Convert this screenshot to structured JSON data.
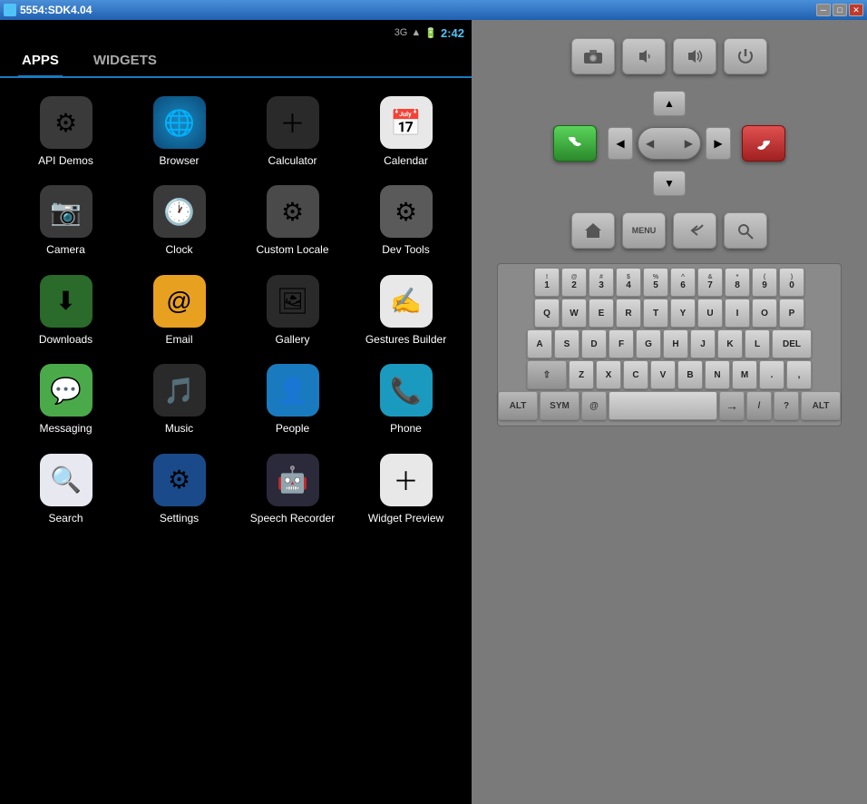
{
  "titleBar": {
    "title": "5554:SDK4.04",
    "minLabel": "─",
    "maxLabel": "□",
    "closeLabel": "✕"
  },
  "statusBar": {
    "signal": "3G",
    "time": "2:42"
  },
  "tabs": [
    {
      "id": "apps",
      "label": "APPS",
      "active": true
    },
    {
      "id": "widgets",
      "label": "WIDGETS",
      "active": false
    }
  ],
  "apps": [
    {
      "id": "api-demos",
      "label": "API Demos",
      "icon": "⚙",
      "iconClass": "icon-api"
    },
    {
      "id": "browser",
      "label": "Browser",
      "icon": "🌐",
      "iconClass": "icon-browser"
    },
    {
      "id": "calculator",
      "label": "Calculator",
      "icon": "＋",
      "iconClass": "icon-calculator"
    },
    {
      "id": "calendar",
      "label": "Calendar",
      "icon": "📅",
      "iconClass": "icon-calendar"
    },
    {
      "id": "camera",
      "label": "Camera",
      "icon": "📷",
      "iconClass": "icon-camera"
    },
    {
      "id": "clock",
      "label": "Clock",
      "icon": "🕐",
      "iconClass": "icon-clock"
    },
    {
      "id": "custom-locale",
      "label": "Custom Locale",
      "icon": "⚙",
      "iconClass": "icon-custom-locale"
    },
    {
      "id": "dev-tools",
      "label": "Dev Tools",
      "icon": "⚙",
      "iconClass": "icon-dev-tools"
    },
    {
      "id": "downloads",
      "label": "Downloads",
      "icon": "⬇",
      "iconClass": "icon-downloads"
    },
    {
      "id": "email",
      "label": "Email",
      "icon": "@",
      "iconClass": "icon-email"
    },
    {
      "id": "gallery",
      "label": "Gallery",
      "icon": "🖼",
      "iconClass": "icon-gallery"
    },
    {
      "id": "gestures",
      "label": "Gestures Builder",
      "icon": "✍",
      "iconClass": "icon-gestures"
    },
    {
      "id": "messaging",
      "label": "Messaging",
      "icon": "💬",
      "iconClass": "icon-messaging"
    },
    {
      "id": "music",
      "label": "Music",
      "icon": "🎵",
      "iconClass": "icon-music"
    },
    {
      "id": "people",
      "label": "People",
      "icon": "👤",
      "iconClass": "icon-people"
    },
    {
      "id": "phone",
      "label": "Phone",
      "icon": "📞",
      "iconClass": "icon-phone"
    },
    {
      "id": "search",
      "label": "Search",
      "icon": "🔍",
      "iconClass": "icon-search"
    },
    {
      "id": "settings",
      "label": "Settings",
      "icon": "⚙",
      "iconClass": "icon-settings"
    },
    {
      "id": "speech",
      "label": "Speech Recorder",
      "icon": "🤖",
      "iconClass": "icon-speech"
    },
    {
      "id": "widget-preview",
      "label": "Widget Preview",
      "icon": "＋",
      "iconClass": "icon-widget"
    }
  ],
  "controls": {
    "cameraBtn": "📷",
    "volDownBtn": "🔉",
    "volUpBtn": "🔊",
    "powerBtn": "⏻",
    "dpadUp": "▲",
    "dpadDown": "▼",
    "dpadLeft": "◀",
    "dpadRight": "▶",
    "callGreen": "📞",
    "callRed": "📞",
    "homeBtn": "⌂",
    "menuBtn": "MENU",
    "backBtn": "↩",
    "searchBtn": "🔍"
  },
  "keyboard": {
    "row1": [
      {
        "label": "1",
        "sub": "!"
      },
      {
        "label": "2",
        "sub": "@"
      },
      {
        "label": "3",
        "sub": "#"
      },
      {
        "label": "4",
        "sub": "$"
      },
      {
        "label": "5",
        "sub": "%"
      },
      {
        "label": "6",
        "sub": "^"
      },
      {
        "label": "7",
        "sub": "&"
      },
      {
        "label": "8",
        "sub": "*"
      },
      {
        "label": "9",
        "sub": "("
      },
      {
        "label": "0",
        "sub": ")"
      }
    ],
    "row2": [
      "Q",
      "W",
      "E",
      "R",
      "T",
      "Y",
      "U",
      "I",
      "O",
      "P"
    ],
    "row3": [
      "A",
      "S",
      "D",
      "F",
      "G",
      "H",
      "J",
      "K",
      "L",
      "DEL"
    ],
    "row4": [
      "⇧",
      "Z",
      "X",
      "C",
      "V",
      "B",
      "N",
      "M",
      ".",
      ","
    ],
    "row5": [
      {
        "label": "ALT",
        "wide": true
      },
      {
        "label": "SYM",
        "wide": true
      },
      {
        "label": "@"
      },
      {
        "label": "space",
        "space": true
      },
      {
        "label": "→"
      },
      {
        "label": "/"
      },
      {
        "label": "?"
      },
      {
        "label": "ALT",
        "wide": true
      }
    ]
  }
}
